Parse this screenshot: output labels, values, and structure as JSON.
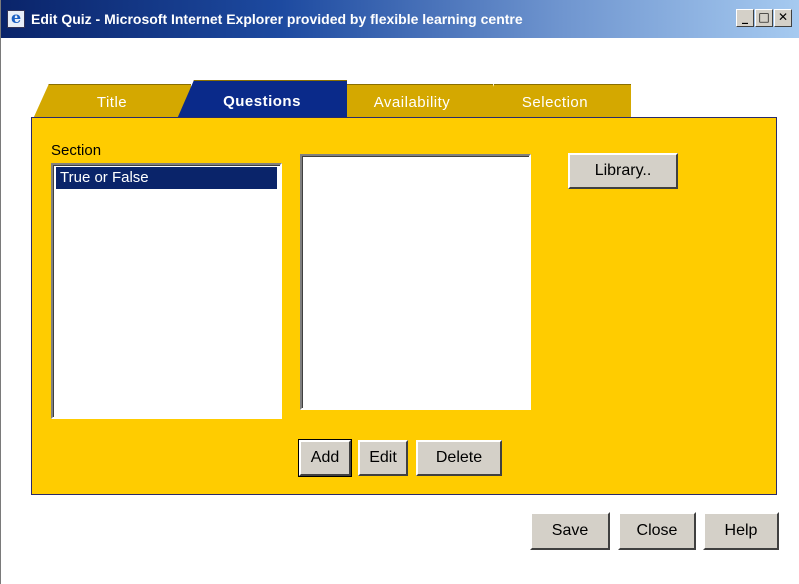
{
  "window": {
    "title": "Edit Quiz - Microsoft Internet Explorer provided by flexible learning centre",
    "minimize_glyph": "_",
    "maximize_glyph": "□",
    "close_glyph": "✕"
  },
  "tabs": [
    {
      "label": "Title",
      "active": false
    },
    {
      "label": "Questions",
      "active": true
    },
    {
      "label": "Availability",
      "active": false
    },
    {
      "label": "Selection",
      "active": false
    }
  ],
  "section": {
    "label": "Section",
    "items": [
      "True or False"
    ],
    "selected": "True or False"
  },
  "questions_list": {
    "items": []
  },
  "buttons": {
    "library": "Library..",
    "add": "Add",
    "edit": "Edit",
    "delete": "Delete",
    "save": "Save",
    "close": "Close",
    "help": "Help"
  },
  "colors": {
    "panel": "#ffcc00",
    "tab_inactive": "#d4a800",
    "tab_active": "#0a2a8a",
    "selection": "#0a246a",
    "titlebar": "#0a246a"
  },
  "icons": {
    "app_icon": "ie-browser-icon",
    "minimize": "minimize-icon",
    "maximize": "maximize-icon",
    "close": "close-icon"
  }
}
